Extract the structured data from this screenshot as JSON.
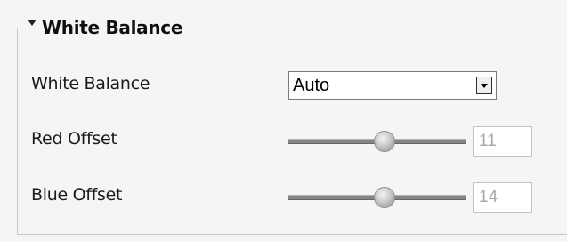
{
  "section": {
    "title": "White Balance",
    "collapse_icon": "triangle-down-icon"
  },
  "white_balance": {
    "label": "White Balance",
    "selected": "Auto",
    "dropdown_icon": "chevron-down-icon"
  },
  "red_offset": {
    "label": "Red Offset",
    "value": "11",
    "slider_fraction": 0.54
  },
  "blue_offset": {
    "label": "Blue Offset",
    "value": "14",
    "slider_fraction": 0.54
  }
}
